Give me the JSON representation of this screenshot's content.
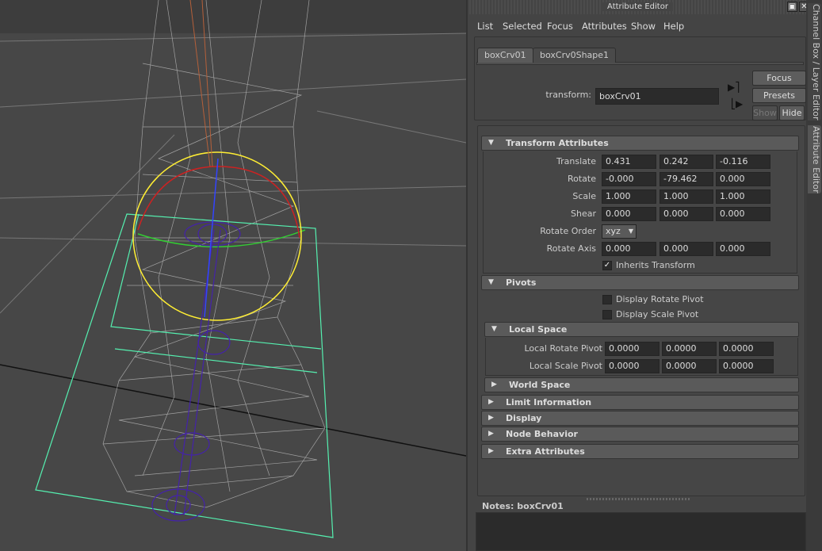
{
  "viewport": {
    "colors": {
      "wireframe": "#b8b8b8",
      "box_curve": "#55f0b0",
      "yellow_circle": "#ffee33",
      "red_arc": "#cc2222",
      "green_arc": "#33cc33",
      "joints": "#4422aa",
      "blue_axis": "#3344ff"
    }
  },
  "window": {
    "title": "Attribute Editor",
    "restore_icon": "restore-icon",
    "close_icon": "close-icon"
  },
  "menu": [
    "List",
    "Selected",
    "Focus",
    "Attributes",
    "Show",
    "Help"
  ],
  "tabs": [
    "boxCrv01",
    "boxCrv0Shape1"
  ],
  "side_tabs": [
    "Channel Box / Layer Editor",
    "Attribute Editor"
  ],
  "node": {
    "label": "transform:",
    "value": "boxCrv01"
  },
  "buttons": {
    "focus": "Focus",
    "presets": "Presets",
    "show": "Show",
    "hide": "Hide"
  },
  "transform": {
    "header": "Transform Attributes",
    "rows": [
      {
        "label": "Translate",
        "values": [
          "0.431",
          "0.242",
          "-0.116"
        ]
      },
      {
        "label": "Rotate",
        "values": [
          "-0.000",
          "-79.462",
          "0.000"
        ]
      },
      {
        "label": "Scale",
        "values": [
          "1.000",
          "1.000",
          "1.000"
        ]
      },
      {
        "label": "Shear",
        "values": [
          "0.000",
          "0.000",
          "0.000"
        ]
      }
    ],
    "rotate_order_label": "Rotate Order",
    "rotate_order": "xyz",
    "rotate_axis": {
      "label": "Rotate Axis",
      "values": [
        "0.000",
        "0.000",
        "0.000"
      ]
    },
    "inherits": {
      "label": "Inherits Transform",
      "checked": true
    }
  },
  "pivots": {
    "header": "Pivots",
    "display_rotate": {
      "label": "Display Rotate Pivot",
      "checked": false
    },
    "display_scale": {
      "label": "Display Scale Pivot",
      "checked": false
    }
  },
  "local_space": {
    "header": "Local Space",
    "rows": [
      {
        "label": "Local Rotate Pivot",
        "values": [
          "0.0000",
          "0.0000",
          "0.0000"
        ]
      },
      {
        "label": "Local Scale Pivot",
        "values": [
          "0.0000",
          "0.0000",
          "0.0000"
        ]
      }
    ]
  },
  "collapsed_sections": [
    "World Space",
    "Limit Information",
    "Display",
    "Node Behavior",
    "Extra Attributes"
  ],
  "notes": {
    "label": "Notes:  boxCrv01",
    "value": ""
  }
}
